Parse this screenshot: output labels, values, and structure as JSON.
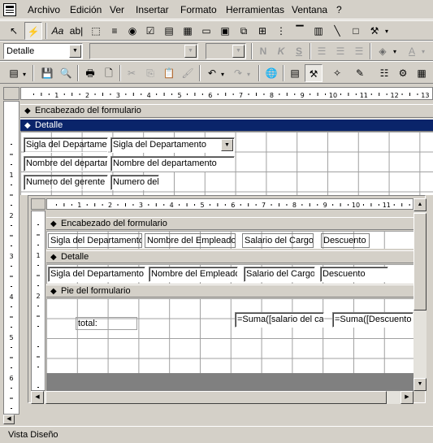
{
  "menu": [
    "Archivo",
    "Edición",
    "Ver",
    "Insertar",
    "Formato",
    "Herramientas",
    "Ventana",
    "?"
  ],
  "toolbar_format": {
    "object_combo": "Detalle",
    "font_combo": "",
    "size_combo": "",
    "bold": "N",
    "italic": "K",
    "underline": "S"
  },
  "subform_section_heading": "Encabezado del formulario",
  "sections": {
    "header": "Encabezado del formulario",
    "detail": "Detalle",
    "footer": "Pie del formulario"
  },
  "main_controls": [
    {
      "label": "Sigla del Departamen",
      "field": "Sigla del Departamento"
    },
    {
      "label": "Nombre del departam",
      "field": "Nombre del departamento"
    },
    {
      "label": "Numero del gerente",
      "field": "Numero del"
    }
  ],
  "subform": {
    "header_labels": [
      "Sigla del Departamento",
      "Nombre del Empleado",
      "Salario del Cargo",
      "Descuento"
    ],
    "detail_fields": [
      "Sigla del Departamento",
      "Nombre del Empleado",
      "Salario del Cargo",
      "Descuento"
    ],
    "footer_label": "total:",
    "footer_fields": [
      "=Suma([salario del car",
      "=Suma([Descuento"
    ]
  },
  "ruler_numbers": [
    "1",
    "2",
    "3",
    "4",
    "5",
    "6",
    "7",
    "8",
    "9",
    "10",
    "11",
    "12",
    "13"
  ],
  "status_text": "Vista Diseño"
}
